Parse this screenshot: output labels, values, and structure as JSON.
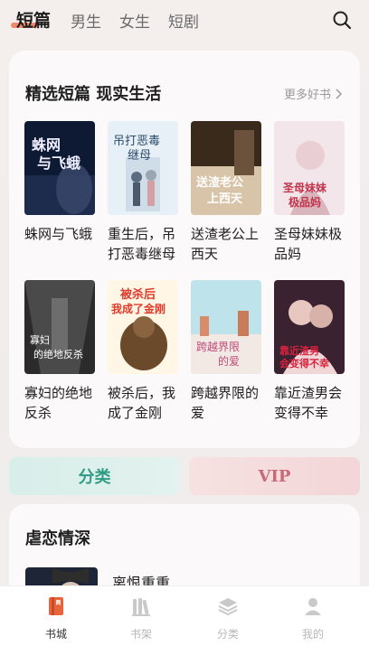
{
  "tabs": [
    {
      "label": "短篇",
      "active": true
    },
    {
      "label": "男生"
    },
    {
      "label": "女生"
    },
    {
      "label": "短剧"
    }
  ],
  "section1": {
    "title": "精选短篇 现实生活",
    "more": "更多好书",
    "books": [
      {
        "title": "蛛网与飞蛾",
        "cover_text": "蛛网与飞蛾"
      },
      {
        "title": "重生后，吊打恶毒继母",
        "cover_text": "吊打恶毒继母"
      },
      {
        "title": "送渣老公上西天",
        "cover_text": "送渣老公上西天"
      },
      {
        "title": "圣母妹妹极品妈",
        "cover_text": "圣母妹妹极品妈"
      },
      {
        "title": "寡妇的绝地反杀",
        "cover_text": "寡妇的绝地反杀"
      },
      {
        "title": "被杀后，我成了金刚",
        "cover_text": "被杀后我成了金刚"
      },
      {
        "title": "跨越界限的爱",
        "cover_text": "跨越界限的爱"
      },
      {
        "title": "靠近渣男会变得不幸",
        "cover_text": "靠近渣男会变得不幸"
      }
    ]
  },
  "quick": {
    "category": "分类",
    "vip": "VIP"
  },
  "section2": {
    "title": "虐恋情深",
    "books": [
      {
        "title": "离恨重重"
      }
    ]
  },
  "nav": [
    {
      "label": "书城",
      "icon": "book-city-icon",
      "active": true
    },
    {
      "label": "书架",
      "icon": "bookshelf-icon"
    },
    {
      "label": "分类",
      "icon": "category-icon"
    },
    {
      "label": "我的",
      "icon": "profile-icon"
    }
  ],
  "colors": {
    "accent": "#e8643d",
    "teal": "#2f9b85",
    "vip": "#c7697a"
  }
}
